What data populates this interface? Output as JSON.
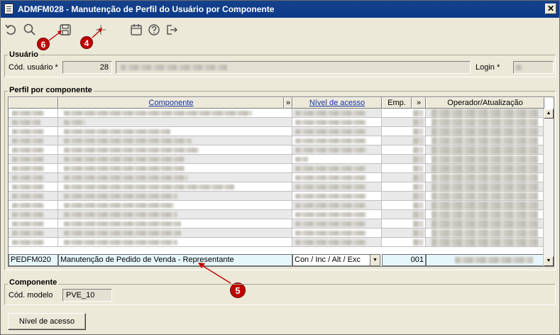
{
  "window": {
    "title": "ADMFM028 - Manutenção de Perfil do Usuário por Componente",
    "close_label": "✕"
  },
  "toolbar": {
    "icons": [
      "undo-icon",
      "search-icon",
      "save-icon",
      "add-icon",
      "calendar-icon",
      "help-icon",
      "exit-icon"
    ]
  },
  "markers": {
    "m6": "6",
    "m4": "4",
    "m5": "5"
  },
  "usuario": {
    "group_title": "Usuário",
    "cod_label": "Cód. usuário *",
    "cod_value": "28",
    "login_label": "Login *"
  },
  "perfil": {
    "group_title": "Perfil por componente",
    "headers": {
      "componente": "Componente",
      "expand1": "»",
      "nivel": "Nível de acesso",
      "emp": "Emp.",
      "expand2": "»",
      "operador": "Operador/Atualização"
    },
    "selected_row": {
      "code": "PEDFM020",
      "componente": "Manutenção de Pedido de Venda - Representante",
      "nivel": "Con / Inc / Alt / Exc",
      "emp": "001"
    }
  },
  "componente": {
    "group_title": "Componente",
    "modelo_label": "Cód. modelo",
    "modelo_value": "PVE_10"
  },
  "buttons": {
    "nivel_acesso": "Nível de acesso"
  }
}
